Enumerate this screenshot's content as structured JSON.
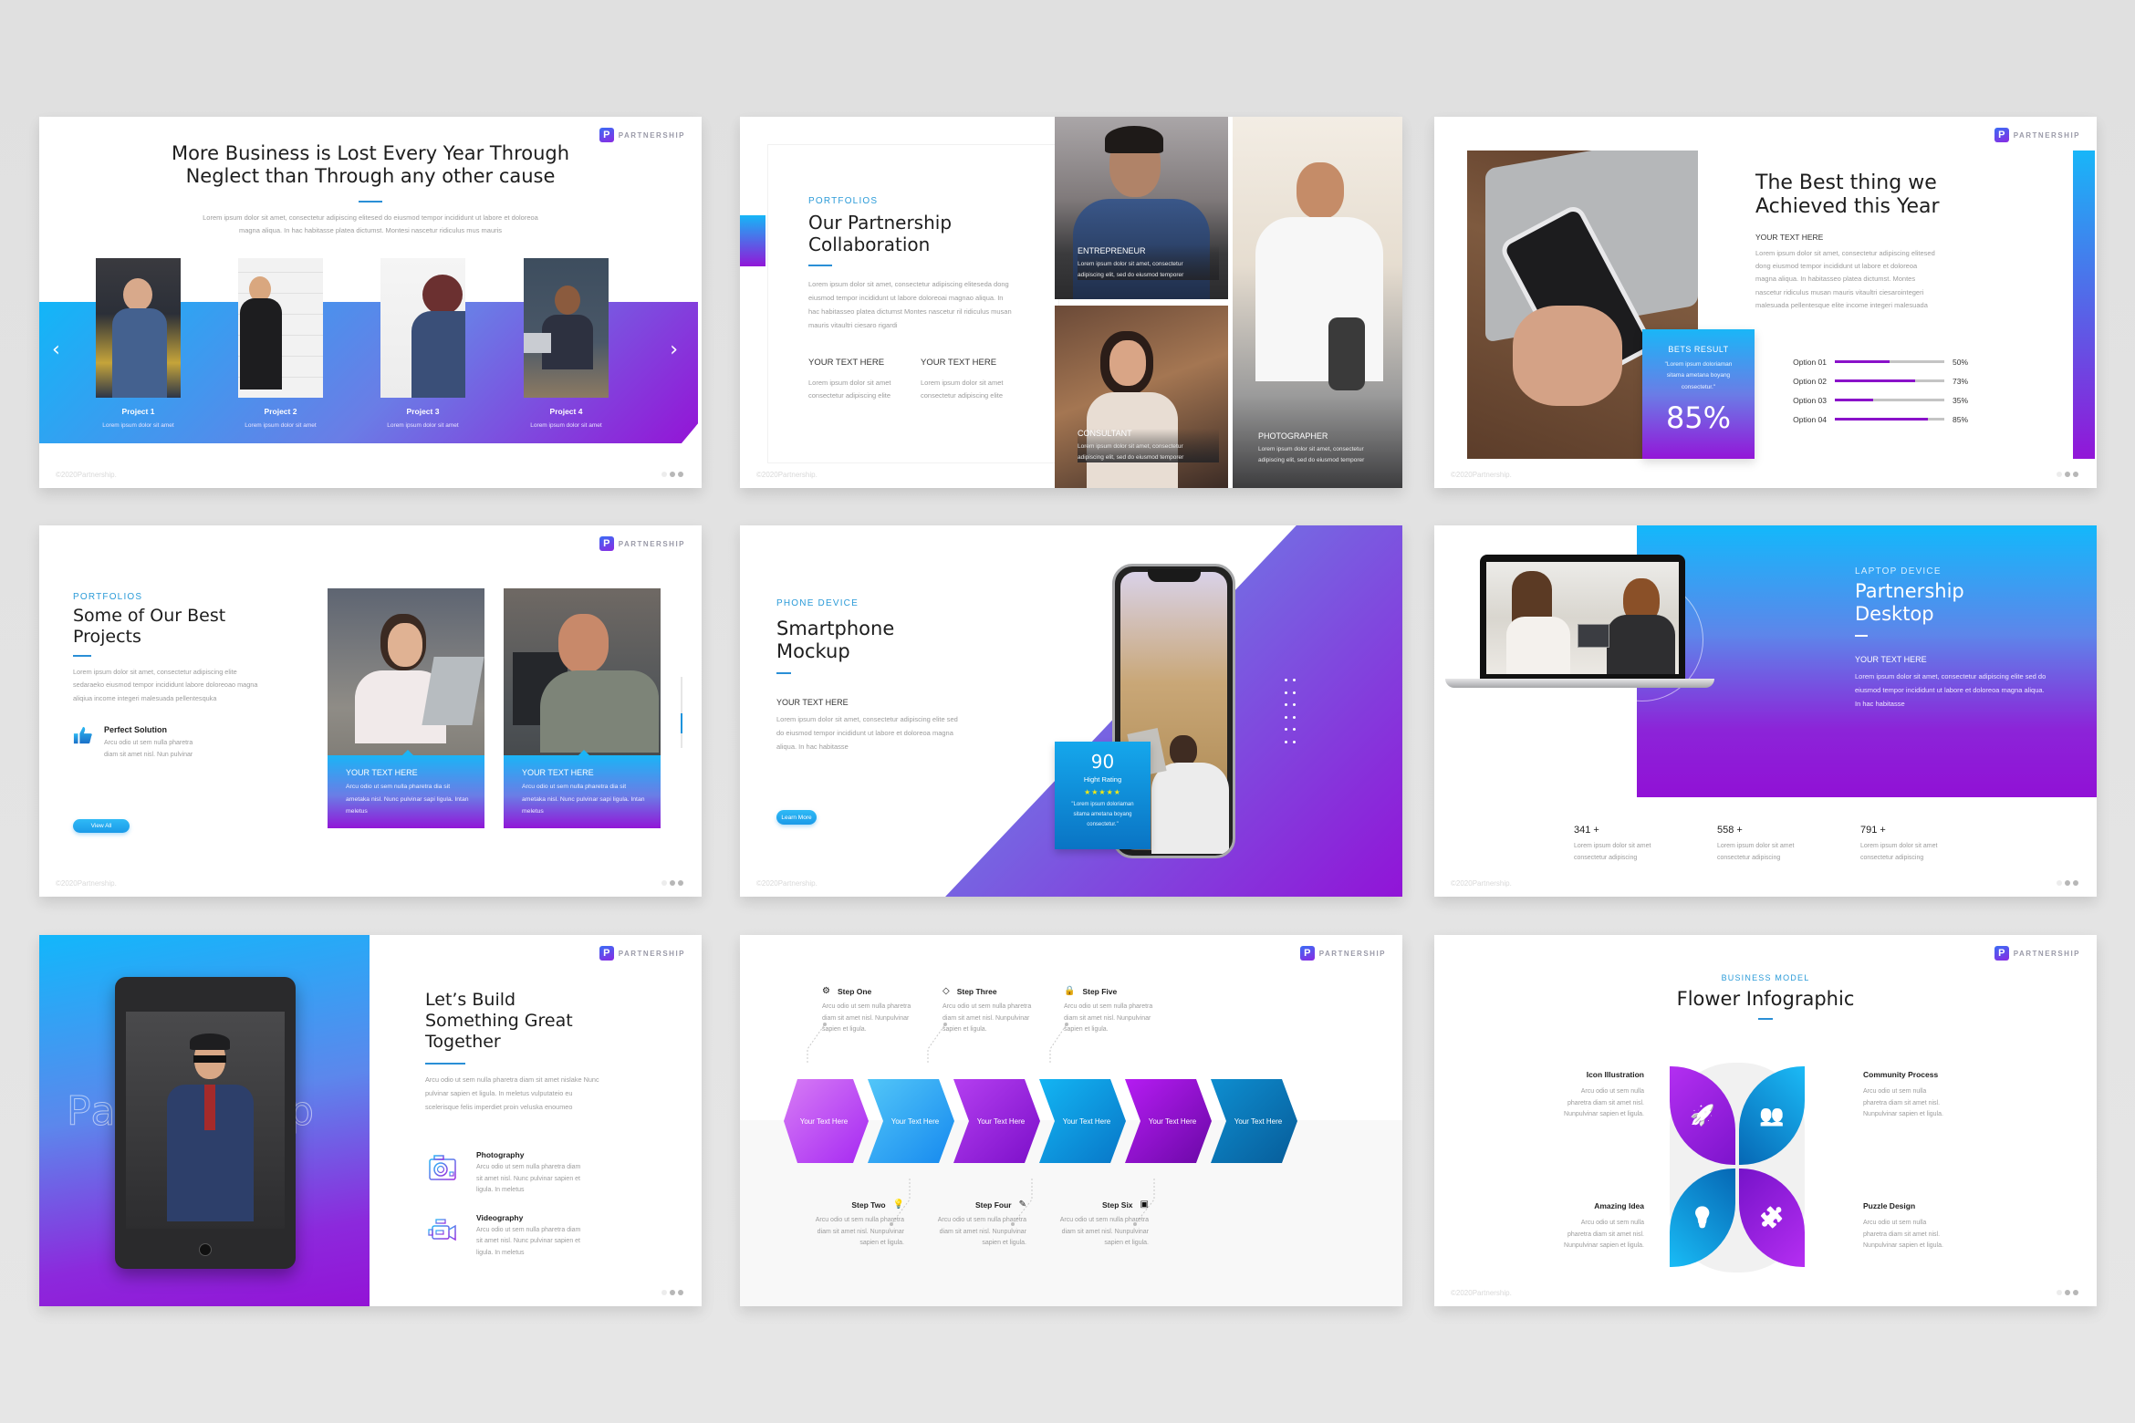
{
  "common": {
    "logo_letter": "P",
    "logo_text": "PARTNERSHIP",
    "copyright": "©2020Partnership.",
    "accent_blue": "#1ab6f7",
    "accent_purple": "#9316d8",
    "underline_color": "#2a8fd6"
  },
  "slide1": {
    "title_line1": "More Business is Lost Every Year Through",
    "title_line2": "Neglect than Through any other cause",
    "body_line1": "Lorem ipsum dolor sit amet, consectetur adipiscing elitesed do eiusmod tempor incididunt ut labore et doloreoa",
    "body_line2": "magna aliqua. In hac habitasse platea dictumst. Montesi nascetur ridiculus mus mauris",
    "prev_icon": "chevron-left-icon",
    "next_icon": "chevron-right-icon",
    "projects": [
      {
        "name": "Project 1",
        "desc": "Lorem ipsum dolor sit amet"
      },
      {
        "name": "Project 2",
        "desc": "Lorem ipsum dolor sit amet"
      },
      {
        "name": "Project 3",
        "desc": "Lorem ipsum dolor sit amet"
      },
      {
        "name": "Project 4",
        "desc": "Lorem ipsum dolor sit amet"
      }
    ]
  },
  "slide2": {
    "kicker": "PORTFOLIOS",
    "title_line1": "Our Partnership",
    "title_line2": "Collaboration",
    "body": "Lorem ipsum dolor sit amet, consectetur adipiscing eliteseda dong eiusmod tempor incididunt ut labore doloreoai magnao aliqua. In hac habitasseo platea dictumst Montes nascetur ril ridiculus musan mauris vitaultri ciesaro rigardi",
    "columns": [
      {
        "head": "YOUR TEXT HERE",
        "body": "Lorem ipsum dolor sit amet consectetur adipiscing elite"
      },
      {
        "head": "YOUR TEXT HERE",
        "body": "Lorem ipsum dolor sit amet consectetur adipiscing elite"
      }
    ],
    "roles": [
      {
        "title": "ENTREPRENEUR",
        "desc": "Lorem ipsum dolor sit amet, consectetur adipiscing elit, sed do eiusmod temporer"
      },
      {
        "title": "CONSULTANT",
        "desc": "Lorem ipsum dolor sit amet, consectetur adipiscing elit, sed do eiusmod temporer"
      },
      {
        "title": "PHOTOGRAPHER",
        "desc": "Lorem ipsum dolor sit amet, consectetur adipiscing elit, sed do eiusmod temporer"
      }
    ]
  },
  "slide3": {
    "title_line1": "The Best thing we",
    "title_line2": "Achieved this Year",
    "subhead": "YOUR TEXT HERE",
    "body": "Lorem ipsum dolor sit amet, consectetur adipiscing elitesed dong eiusmod tempor incididunt ut labore et doloreoa magna aliqua. In habitasseo platea dictumst. Montes nascetur ridiculus musan mauris vitaultri ciesarointegeri malesuada pellentesque elite income integeri malesuada",
    "bets": {
      "label": "BETS RESULT",
      "quote": "\"Lorem ipsum doloriaman sitama ametana boyang consectetur.\"",
      "value": "85%"
    },
    "options": [
      {
        "label": "Option 01",
        "value": 50,
        "display": "50%"
      },
      {
        "label": "Option 02",
        "value": 73,
        "display": "73%"
      },
      {
        "label": "Option 03",
        "value": 35,
        "display": "35%"
      },
      {
        "label": "Option 04",
        "value": 85,
        "display": "85%"
      }
    ],
    "bar_color": "#8a12c9",
    "track_color": "#c4c4c4"
  },
  "slide4": {
    "kicker": "PORTFOLIOS",
    "title_line1": "Some of Our Best",
    "title_line2": "Projects",
    "body": "Lorem ipsum dolor sit amet, consectetur adipiscing elite sedaraeko eiusmod tempor incididunt labore doloreoao magna aliqiua income integeri malesuada pellentesquka",
    "feature_icon": "thumbs-up-icon",
    "feature_title": "Perfect Solution",
    "feature_body": "Arcu odio ut sem nulla pharetra diam sit amet nisl. Nun pulvinar",
    "button": "View All",
    "cards": [
      {
        "head": "YOUR TEXT HERE",
        "body": "Arcu odio ut sem nulla pharetra dia sit ametaka nisl. Nunc pulvinar sapi ligula. Intan meletus"
      },
      {
        "head": "YOUR TEXT HERE",
        "body": "Arcu odio ut sem nulla pharetra dia sit ametaka nisl. Nunc pulvinar sapi ligula. Intan meletus"
      }
    ]
  },
  "slide5": {
    "kicker": "PHONE DEVICE",
    "title_line1": "Smartphone",
    "title_line2": "Mockup",
    "subhead": "YOUR TEXT HERE",
    "body": "Lorem ipsum dolor sit amet, consectetur adipiscing elite sed do eiusmod tempor incididunt ut labore et doloreoa magna aliqua. In hac habitasse",
    "button": "Learn More",
    "rating": {
      "value": "90",
      "label": "Hight Rating",
      "stars": 5,
      "stars_text": "★★★★★",
      "quote": "\"Lorem ipsum doloriaman sitama ametana boyang consectetur.\""
    }
  },
  "slide6": {
    "kicker": "LAPTOP DEVICE",
    "title_line1": "Partnership",
    "title_line2": "Desktop",
    "subhead": "YOUR TEXT HERE",
    "body": "Lorem ipsum dolor sit amet, consectetur adipiscing elite sed do eiusmod tempor incididunt ut labore et doloreoa magna aliqua. In hac habitasse",
    "stats": [
      {
        "value": "341 +",
        "desc": "Lorem ipsum dolor sit amet consectetur adipiscing"
      },
      {
        "value": "558 +",
        "desc": "Lorem ipsum dolor sit amet consectetur adipiscing"
      },
      {
        "value": "791 +",
        "desc": "Lorem ipsum dolor sit amet consectetur adipiscing"
      }
    ]
  },
  "slide7": {
    "watermark": "Partnership",
    "title_line1": "Let’s Build",
    "title_line2": "Something Great",
    "title_line3": "Together",
    "body": "Arcu odio ut sem nulla pharetra diam sit amet nislake Nunc pulvinar sapien et ligula. In meletus vulputateio eu scelerisque felis imperdiet proin veluska enoumeo",
    "features": [
      {
        "icon": "camera-icon",
        "title": "Photography",
        "body": "Arcu odio ut sem nulla pharetra diam sit amet nisl. Nunc pulvinar sapien et ligula. In meletus"
      },
      {
        "icon": "video-camera-icon",
        "title": "Videography",
        "body": "Arcu odio ut sem nulla pharetra diam sit amet nisl. Nunc pulvinar sapien et ligula. In meletus"
      }
    ]
  },
  "slide8": {
    "hex_label": "Your Text Here",
    "hex_colors": [
      [
        "#d77cf5",
        "#a629f2"
      ],
      [
        "#52c6f8",
        "#1689ef"
      ],
      [
        "#b43ff0",
        "#7c0fc9"
      ],
      [
        "#13b5f3",
        "#0876c7"
      ],
      [
        "#b51cf2",
        "#6a08a6"
      ],
      [
        "#0e8ed0",
        "#075c99"
      ]
    ],
    "steps": [
      {
        "title": "Step One",
        "icon": "gear-icon",
        "body": "Arcu odio ut sem nulla pharetra diam sit amet nisl. Nunpulvinar sapien et ligula."
      },
      {
        "title": "Step Two",
        "icon": "lightbulb-icon",
        "body": "Arcu odio ut sem nulla pharetra diam sit amet nisl. Nunpulvinar sapien et ligula."
      },
      {
        "title": "Step Three",
        "icon": "diamond-icon",
        "body": "Arcu odio ut sem nulla pharetra diam sit amet nisl. Nunpulvinar sapien et ligula."
      },
      {
        "title": "Step Four",
        "icon": "pencil-icon",
        "body": "Arcu odio ut sem nulla pharetra diam sit amet nisl. Nunpulvinar sapien et ligula."
      },
      {
        "title": "Step Five",
        "icon": "lock-icon",
        "body": "Arcu odio ut sem nulla pharetra diam sit amet nisl. Nunpulvinar sapien et ligula."
      },
      {
        "title": "Step Six",
        "icon": "save-icon",
        "body": "Arcu odio ut sem nulla pharetra diam sit amet nisl. Nunpulvinar sapien et ligula."
      }
    ]
  },
  "slide9": {
    "kicker": "BUSINESS MODEL",
    "title": "Flower Infographic",
    "petals": [
      {
        "title": "Icon Illustration",
        "icon": "rocket-icon",
        "body": "Arcu odio ut sem nulla pharetra diam sit amet nisl. Nunpulvinar sapien et ligula."
      },
      {
        "title": "Community Process",
        "icon": "users-icon",
        "body": "Arcu odio ut sem nulla pharetra diam sit amet nisl. Nunpulvinar sapien et ligula."
      },
      {
        "title": "Amazing Idea",
        "icon": "lightbulb-icon",
        "body": "Arcu odio ut sem nulla pharetra diam sit amet nisl. Nunpulvinar sapien et ligula."
      },
      {
        "title": "Puzzle Design",
        "icon": "puzzle-icon",
        "body": "Arcu odio ut sem nulla pharetra diam sit amet nisl. Nunpulvinar sapien et ligula."
      }
    ]
  }
}
